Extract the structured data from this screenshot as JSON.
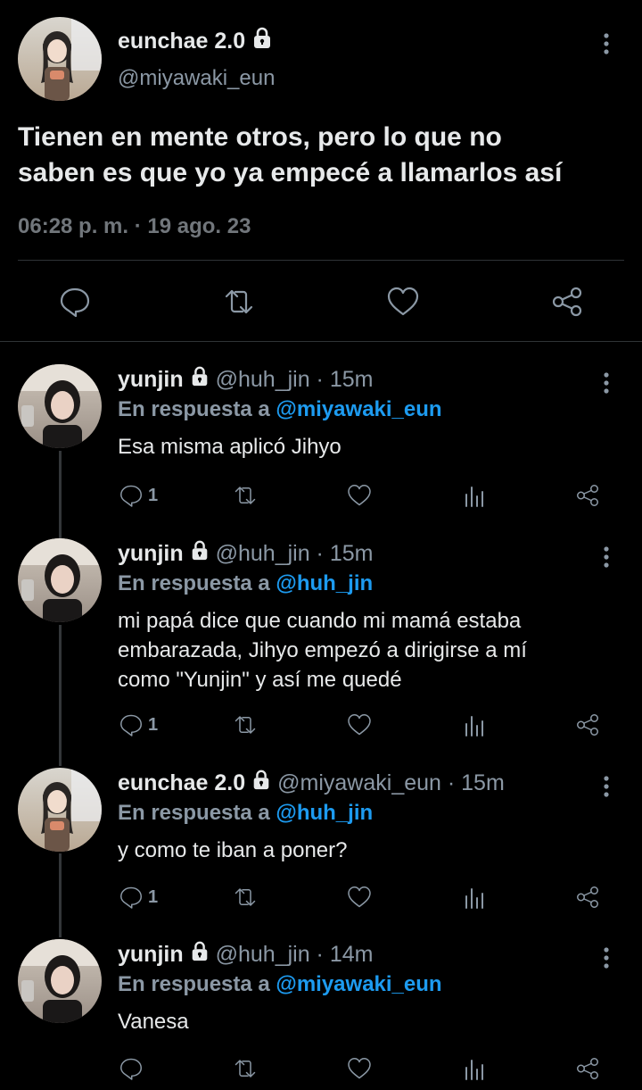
{
  "main_tweet": {
    "display_name": "eunchae 2.0",
    "handle": "@miyawaki_eun",
    "text_line1": "Tienen en mente otros, pero lo que no",
    "text_line2": "saben es que yo ya empecé a llamarlos así",
    "meta": "06:28 p. m. · 19 ago. 23"
  },
  "replies": [
    {
      "display_name": "yunjin",
      "handle_time": "@huh_jin · 15m",
      "reply_prefix": "En respuesta a",
      "reply_to": "@miyawaki_eun",
      "body": [
        "Esa misma aplicó Jihyo"
      ],
      "reply_count": "1"
    },
    {
      "display_name": "yunjin",
      "handle_time": "@huh_jin · 15m",
      "reply_prefix": "En respuesta a",
      "reply_to": "@huh_jin",
      "body": [
        "mi papá dice que cuando mi mamá estaba",
        "embarazada, Jihyo empezó a dirigirse a mí",
        "como \"Yunjin\" y así me quedé"
      ],
      "reply_count": "1"
    },
    {
      "display_name": "eunchae 2.0",
      "handle_time": "@miyawaki_eun · 15m",
      "reply_prefix": "En respuesta a",
      "reply_to": "@huh_jin",
      "body": [
        "y como te iban a poner?"
      ],
      "reply_count": "1"
    },
    {
      "display_name": "yunjin",
      "handle_time": "@huh_jin · 14m",
      "reply_prefix": "En respuesta a",
      "reply_to": "@miyawaki_eun",
      "body": [
        "Vanesa"
      ],
      "reply_count": ""
    }
  ],
  "icons": {
    "reply": "reply-icon",
    "retweet": "retweet-icon",
    "like": "heart-icon",
    "views": "analytics-icon",
    "share": "share-icon",
    "more": "more-vertical-icon",
    "lock": "lock-icon"
  },
  "colors": {
    "background": "#000000",
    "text": "#e7e9ea",
    "secondary": "#8b98a5",
    "mention": "#1d9bf0",
    "divider": "#2f3336"
  }
}
